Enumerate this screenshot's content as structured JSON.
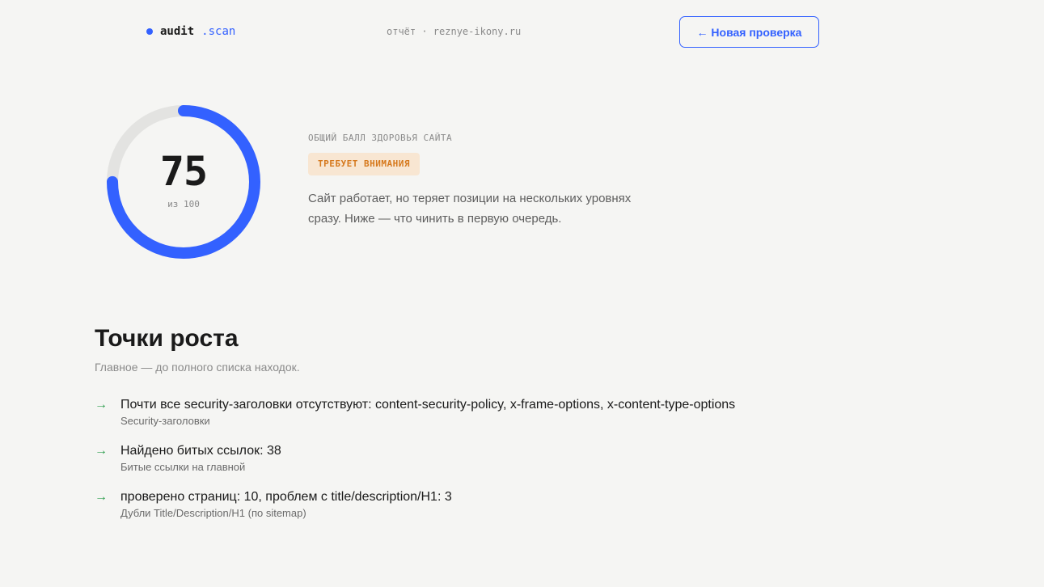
{
  "header": {
    "logo_main": "audit",
    "logo_accent": ".scan",
    "report_label": "отчёт · reznye-ikony.ru",
    "new_check_label": "← Новая проверка"
  },
  "score": {
    "value": "75",
    "max_label": "из 100",
    "fraction": 0.75,
    "ring_color": "#3361ff",
    "track_color": "#e3e3e1",
    "caption": "ОБЩИЙ БАЛЛ ЗДОРОВЬЯ САЙТА",
    "status": "ТРЕБУЕТ ВНИМАНИЯ",
    "status_color": "#d6791d",
    "description": "Сайт работает, но теряет позиции на нескольких уровнях сразу. Ниже — что чинить в первую очередь."
  },
  "growth": {
    "title": "Точки роста",
    "subtitle": "Главное — до полного списка находок.",
    "arrow_icon": "→",
    "items": [
      {
        "title": "Почти все security-заголовки отсутствуют: content-security-policy, x-frame-options, x-content-type-options",
        "subtitle": "Security-заголовки"
      },
      {
        "title": "Найдено битых ссылок: 38",
        "subtitle": "Битые ссылки на главной"
      },
      {
        "title": "проверено страниц: 10, проблем с title/description/H1: 3",
        "subtitle": "Дубли Title/Description/H1 (по sitemap)"
      }
    ]
  }
}
